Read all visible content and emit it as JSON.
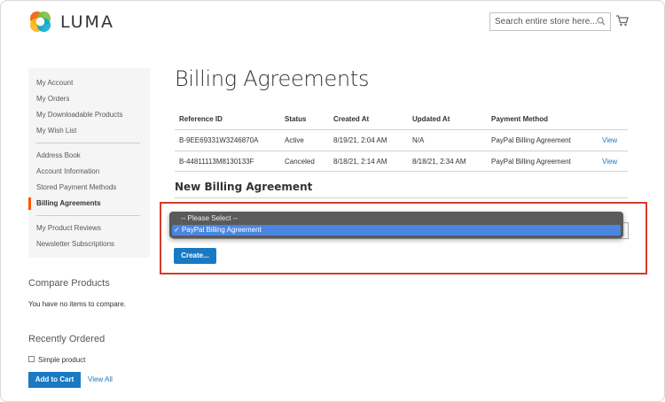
{
  "header": {
    "brand": "LUMA",
    "search_placeholder": "Search entire store here..."
  },
  "sidebar": {
    "items": [
      {
        "label": "My Account"
      },
      {
        "label": "My Orders"
      },
      {
        "label": "My Downloadable Products"
      },
      {
        "label": "My Wish List"
      },
      {
        "label": "Address Book"
      },
      {
        "label": "Account Information"
      },
      {
        "label": "Stored Payment Methods"
      },
      {
        "label": "Billing Agreements",
        "active": true
      },
      {
        "label": "My Product Reviews"
      },
      {
        "label": "Newsletter Subscriptions"
      }
    ],
    "compare": {
      "title": "Compare Products",
      "text": "You have no items to compare."
    },
    "recent": {
      "title": "Recently Ordered",
      "product": "Simple product",
      "add_to_cart": "Add to Cart",
      "view_all": "View All"
    }
  },
  "main": {
    "title": "Billing Agreements",
    "table": {
      "headers": [
        "Reference ID",
        "Status",
        "Created At",
        "Updated At",
        "Payment Method"
      ],
      "rows": [
        {
          "ref": "B-9EE69331W3246870A",
          "status": "Active",
          "created": "8/19/21, 2:04 AM",
          "updated": "N/A",
          "method": "PayPal Billing Agreement",
          "action": "View"
        },
        {
          "ref": "B-44811113M8130133F",
          "status": "Canceled",
          "created": "8/18/21, 2:14 AM",
          "updated": "8/18/21, 2:34 AM",
          "method": "PayPal Billing Agreement",
          "action": "View"
        }
      ]
    },
    "new_agreement": {
      "title": "New Billing Agreement",
      "options": [
        "-- Please Select --",
        "PayPal Billing Agreement"
      ],
      "selected_mark": "✓",
      "create_button": "Create..."
    }
  },
  "colors": {
    "accent": "#1979c3",
    "active_bar": "#ff5501",
    "highlight": "#d63b2b",
    "dropdown_selected": "#4a86e0"
  }
}
